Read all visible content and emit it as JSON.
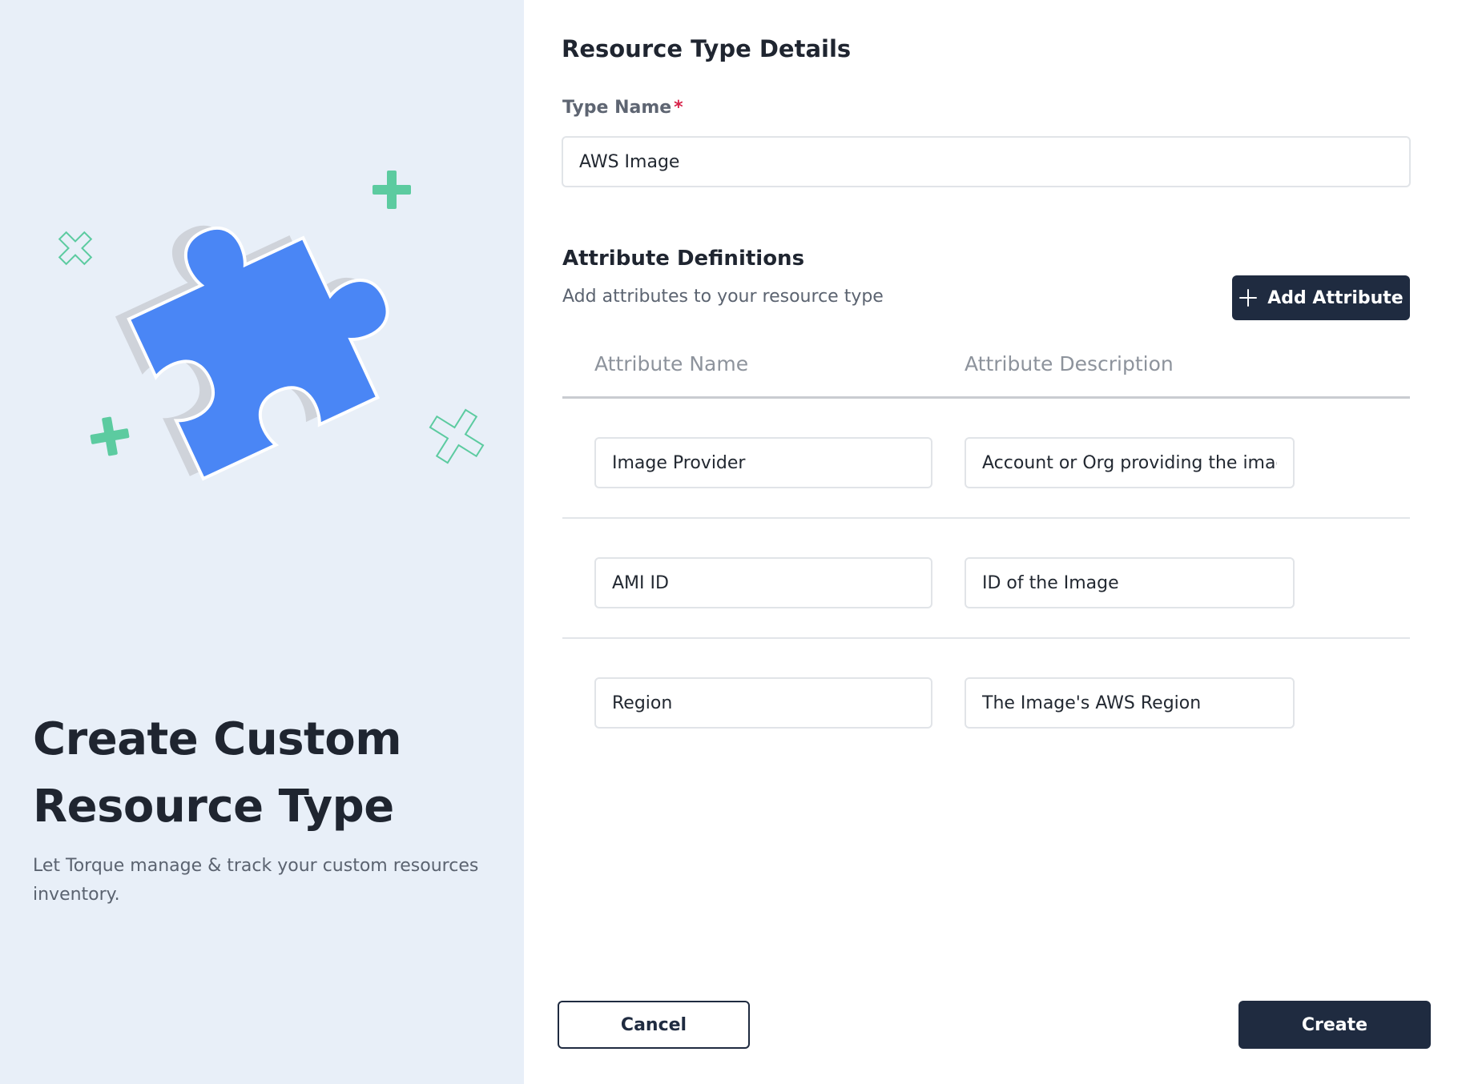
{
  "colors": {
    "left_panel_bg": "#e8eff8",
    "primary_dark": "#1f2b40",
    "puzzle_blue": "#4a86f5",
    "accent_green": "#5ccba0",
    "required_red": "#d8234a"
  },
  "intro": {
    "title_line1": "Create Custom",
    "title_line2": "Resource Type",
    "subtitle": "Let Torque manage & track your custom resources inventory."
  },
  "icons": {
    "illustration": "puzzle-piece-icon",
    "add": "plus-icon"
  },
  "resource_type": {
    "section_title": "Resource Type Details",
    "type_name_label": "Type Name",
    "required_marker": "*",
    "type_name_value": "AWS Image"
  },
  "attributes": {
    "section_title": "Attribute Definitions",
    "subtitle": "Add attributes to your resource type",
    "add_button_label": "Add Attribute",
    "columns": {
      "name": "Attribute Name",
      "description": "Attribute Description"
    },
    "rows": [
      {
        "name": "Image Provider",
        "description": "Account or Org providing the imag"
      },
      {
        "name": "AMI ID",
        "description": "ID of the Image"
      },
      {
        "name": "Region",
        "description": "The Image's AWS Region"
      }
    ]
  },
  "footer": {
    "cancel_label": "Cancel",
    "create_label": "Create"
  }
}
